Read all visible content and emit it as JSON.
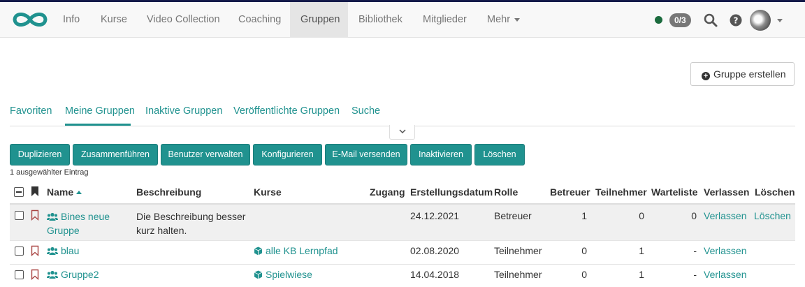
{
  "nav": {
    "items": [
      "Info",
      "Kurse",
      "Video Collection",
      "Coaching",
      "Gruppen",
      "Bibliothek",
      "Mitglieder",
      "Mehr"
    ],
    "active": "Gruppen",
    "badge": "0/3"
  },
  "actions": {
    "create_group": "Gruppe erstellen"
  },
  "tabs": [
    "Favoriten",
    "Meine Gruppen",
    "Inaktive Gruppen",
    "Veröffentlichte Gruppen",
    "Suche"
  ],
  "active_tab": "Meine Gruppen",
  "bulk_buttons": [
    "Duplizieren",
    "Zusammenführen",
    "Benutzer verwalten",
    "Konfigurieren",
    "E-Mail versenden",
    "Inaktivieren",
    "Löschen"
  ],
  "selection_info": "1 ausgewählter Eintrag",
  "table": {
    "headers": [
      "Name",
      "Beschreibung",
      "Kurse",
      "Zugang",
      "Erstellungsdatum",
      "Rolle",
      "Betreuer",
      "Teilnehmer",
      "Warteliste",
      "Verlassen",
      "Löschen"
    ],
    "sort_column": "Name",
    "rows": [
      {
        "name": "Bines neue Gruppe",
        "description": "Die Beschreibung besser kurz halten.",
        "course": "",
        "access": "",
        "created": "24.12.2021",
        "role": "Betreuer",
        "coaches": "1",
        "participants": "0",
        "waitlist": "0",
        "leave": "Verlassen",
        "delete": "Löschen"
      },
      {
        "name": "blau",
        "description": "",
        "course": "alle KB Lernpfad",
        "access": "",
        "created": "02.08.2020",
        "role": "Teilnehmer",
        "coaches": "0",
        "participants": "1",
        "waitlist": "-",
        "leave": "Verlassen",
        "delete": ""
      },
      {
        "name": "Gruppe2",
        "description": "",
        "course": "Spielwiese",
        "access": "",
        "created": "14.04.2018",
        "role": "Teilnehmer",
        "coaches": "0",
        "participants": "1",
        "waitlist": "-",
        "leave": "Verlassen",
        "delete": ""
      }
    ]
  },
  "colors": {
    "accent": "#20928f",
    "status_online": "#1b6b3e",
    "bookmark": "#a94442"
  },
  "icons": [
    "infinity-logo-icon",
    "search-icon",
    "help-icon",
    "group-icon",
    "course-icon",
    "bookmark-icon",
    "plus-circle-icon",
    "chevron-down-icon"
  ]
}
